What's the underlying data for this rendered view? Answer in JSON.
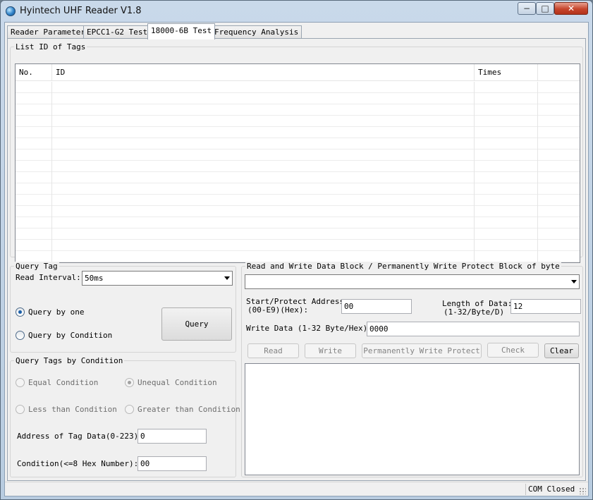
{
  "window": {
    "title": "Hyintech UHF Reader V1.8",
    "controls": {
      "minimize": "−",
      "maximize": "□",
      "close": "✕"
    }
  },
  "tabs": [
    {
      "label": "Reader Parameter",
      "active": false
    },
    {
      "label": "EPCC1-G2 Test",
      "active": false
    },
    {
      "label": "18000-6B Test",
      "active": true
    },
    {
      "label": "Frequency Analysis",
      "active": false
    }
  ],
  "tag_list": {
    "group_label": "List ID of Tags",
    "columns": [
      "No.",
      "ID",
      "Times"
    ],
    "rows": []
  },
  "query_tag": {
    "group_label": "Query Tag",
    "read_interval_label": "Read Interval:",
    "read_interval_value": "50ms",
    "query_by_one_label": "Query by one",
    "query_by_condition_label": "Query by Condition",
    "query_button": "Query"
  },
  "query_condition": {
    "group_label": "Query Tags by Condition",
    "equal_label": "Equal Condition",
    "unequal_label": "Unequal Condition",
    "less_than_label": "Less than Condition",
    "greater_than_label": "Greater than Condition",
    "address_label": "Address of Tag Data(0-223):",
    "address_value": "0",
    "condition_label": "Condition(<=8 Hex Number):",
    "condition_value": "00"
  },
  "read_write": {
    "group_label": "Read and Write Data Block / Permanently Write  Protect Block of  byte",
    "selected_tag": "",
    "start_address_label_line1": "Start/Protect Address",
    "start_address_label_line2": "(00-E9)(Hex):",
    "start_address_value": "00",
    "length_label_line1": "Length of Data:",
    "length_label_line2": "(1-32/Byte/D)",
    "length_value": "12",
    "write_data_label": "Write Data (1-32 Byte/Hex):",
    "write_data_value": "0000",
    "read_button": "Read",
    "write_button": "Write",
    "protect_button": "Permanently Write  Protect",
    "check_button": "Check",
    "clear_button": "Clear",
    "output_text": ""
  },
  "status": {
    "com_state": "COM Closed"
  }
}
